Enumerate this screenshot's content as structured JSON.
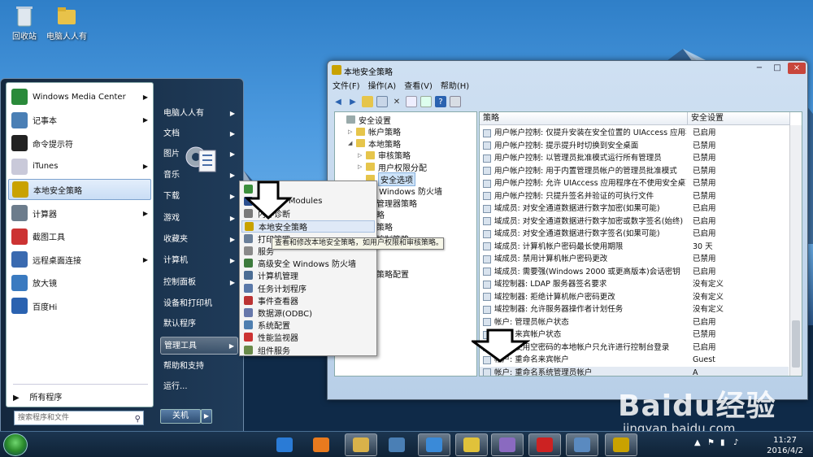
{
  "desktop": {
    "icons": [
      {
        "label": "回收站",
        "icon": "recycle-bin-icon"
      },
      {
        "label": "电脑人人有",
        "icon": "folder-icon"
      }
    ]
  },
  "start_menu": {
    "pinned": [
      {
        "label": "Windows Media Center",
        "icon": "media-center-icon",
        "has_arrow": true
      },
      {
        "label": "记事本",
        "icon": "notepad-icon",
        "has_arrow": true
      },
      {
        "label": "命令提示符",
        "icon": "cmd-icon",
        "has_arrow": false
      },
      {
        "label": "iTunes",
        "icon": "itunes-icon",
        "has_arrow": true
      },
      {
        "label": "本地安全策略",
        "icon": "security-policy-icon",
        "has_arrow": false
      },
      {
        "label": "计算器",
        "icon": "calculator-icon",
        "has_arrow": true
      },
      {
        "label": "截图工具",
        "icon": "snipping-tool-icon",
        "has_arrow": false
      },
      {
        "label": "远程桌面连接",
        "icon": "remote-desktop-icon",
        "has_arrow": true
      },
      {
        "label": "放大镜",
        "icon": "magnifier-icon",
        "has_arrow": false
      },
      {
        "label": "百度Hi",
        "icon": "baidu-hi-icon",
        "has_arrow": false
      }
    ],
    "all_programs": "所有程序",
    "search_placeholder": "搜索程序和文件",
    "right_items": [
      {
        "label": "电脑人人有",
        "has_arrow": true
      },
      {
        "label": "文档",
        "has_arrow": true
      },
      {
        "label": "图片",
        "has_arrow": true
      },
      {
        "label": "音乐",
        "has_arrow": true
      },
      {
        "label": "下载",
        "has_arrow": true
      },
      {
        "label": "游戏",
        "has_arrow": true
      },
      {
        "label": "收藏夹",
        "has_arrow": true
      },
      {
        "label": "计算机",
        "has_arrow": true
      },
      {
        "label": "控制面板",
        "has_arrow": true
      },
      {
        "label": "设备和打印机",
        "has_arrow": false
      },
      {
        "label": "默认程序",
        "has_arrow": false
      },
      {
        "label": "管理工具",
        "has_arrow": true
      },
      {
        "label": "帮助和支持",
        "has_arrow": false
      },
      {
        "label": "运行...",
        "has_arrow": false
      }
    ],
    "shutdown_label": "关机"
  },
  "admin_submenu": {
    "items": [
      {
        "label": "程序",
        "icon": "program-icon",
        "color": "#3c8f3c"
      },
      {
        "label": "erShell Modules",
        "icon": "powershell-icon",
        "color": "#2b4f8f"
      },
      {
        "label": "内存诊断",
        "icon": "memory-icon",
        "color": "#7a7a7a"
      },
      {
        "label": "本地安全策略",
        "icon": "security-policy-icon",
        "color": "#c9a200"
      },
      {
        "label": "打印管理",
        "icon": "printer-icon",
        "color": "#6a7f99"
      },
      {
        "label": "服务",
        "icon": "services-icon",
        "color": "#8a8a8a"
      },
      {
        "label": "高级安全 Windows 防火墙",
        "icon": "firewall-icon",
        "color": "#3d7b3d"
      },
      {
        "label": "计算机管理",
        "icon": "computer-management-icon",
        "color": "#4b6d94"
      },
      {
        "label": "任务计划程序",
        "icon": "task-scheduler-icon",
        "color": "#5a78a8"
      },
      {
        "label": "事件查看器",
        "icon": "event-viewer-icon",
        "color": "#b33"
      },
      {
        "label": "数据源(ODBC)",
        "icon": "odbc-icon",
        "color": "#6677aa"
      },
      {
        "label": "系统配置",
        "icon": "system-config-icon",
        "color": "#4f7fb0"
      },
      {
        "label": "性能监视器",
        "icon": "performance-icon",
        "color": "#c33"
      },
      {
        "label": "组件服务",
        "icon": "component-services-icon",
        "color": "#6a8a4a"
      }
    ],
    "tooltip": "查看和修改本地安全策略，如用户权限和审核策略。"
  },
  "window": {
    "title": "本地安全策略",
    "controls": [
      "−",
      "□",
      "×"
    ],
    "menu": [
      "文件(F)",
      "操作(A)",
      "查看(V)",
      "帮助(H)"
    ],
    "tree": [
      {
        "label": "安全设置",
        "level": 0,
        "expand": ""
      },
      {
        "label": "帐户策略",
        "level": 1,
        "expand": "▷"
      },
      {
        "label": "本地策略",
        "level": 1,
        "expand": "◢"
      },
      {
        "label": "审核策略",
        "level": 2,
        "expand": "▷"
      },
      {
        "label": "用户权限分配",
        "level": 2,
        "expand": "▷"
      },
      {
        "label": "安全选项",
        "level": 2,
        "expand": "",
        "selected": true
      },
      {
        "label": "全 Windows 防火墙",
        "level": 1,
        "expand": ""
      },
      {
        "label": "表管理器策略",
        "level": 1,
        "expand": ""
      },
      {
        "label": "策略",
        "level": 1,
        "expand": ""
      },
      {
        "label": "制策略",
        "level": 1,
        "expand": ""
      },
      {
        "label": "序控制策略",
        "level": 1,
        "expand": ""
      },
      {
        "label": "于",
        "level": 1,
        "expand": ""
      },
      {
        "label": "",
        "level": 1,
        "expand": ""
      },
      {
        "label": "核策略配置",
        "level": 1,
        "expand": ""
      }
    ],
    "columns": [
      "策略",
      "安全设置"
    ],
    "rows": [
      {
        "policy": "用户帐户控制: 仅提升安装在安全位置的 UIAccess 应用程序",
        "setting": "已启用"
      },
      {
        "policy": "用户帐户控制: 提示提升时切换到安全桌面",
        "setting": "已禁用"
      },
      {
        "policy": "用户帐户控制: 以管理员批准模式运行所有管理员",
        "setting": "已禁用"
      },
      {
        "policy": "用户帐户控制: 用于内置管理员帐户的管理员批准模式",
        "setting": "已禁用"
      },
      {
        "policy": "用户帐户控制: 允许 UIAccess 应用程序在不使用安全桌面...",
        "setting": "已禁用"
      },
      {
        "policy": "用户帐户控制: 只提升签名并验证的可执行文件",
        "setting": "已禁用"
      },
      {
        "policy": "域成员: 对安全通道数据进行数字加密(如果可能)",
        "setting": "已启用"
      },
      {
        "policy": "域成员: 对安全通道数据进行数字加密或数字签名(始终)",
        "setting": "已启用"
      },
      {
        "policy": "域成员: 对安全通道数据进行数字签名(如果可能)",
        "setting": "已启用"
      },
      {
        "policy": "域成员: 计算机帐户密码最长使用期限",
        "setting": "30 天"
      },
      {
        "policy": "域成员: 禁用计算机帐户密码更改",
        "setting": "已禁用"
      },
      {
        "policy": "域成员: 需要强(Windows 2000 或更高版本)会话密钥",
        "setting": "已启用"
      },
      {
        "policy": "域控制器: LDAP 服务器签名要求",
        "setting": "没有定义"
      },
      {
        "policy": "域控制器: 拒绝计算机帐户密码更改",
        "setting": "没有定义"
      },
      {
        "policy": "域控制器: 允许服务器操作者计划任务",
        "setting": "没有定义"
      },
      {
        "policy": "帐户: 管理员帐户状态",
        "setting": "已启用"
      },
      {
        "policy": "帐户: 来宾帐户状态",
        "setting": "已禁用"
      },
      {
        "policy": "帐户: 使用空密码的本地帐户只允许进行控制台登录",
        "setting": "已启用"
      },
      {
        "policy": "帐户: 重命名来宾帐户",
        "setting": "Guest"
      },
      {
        "policy": "帐户: 重命名系统管理员帐户",
        "setting": "A",
        "highlight": true
      }
    ]
  },
  "taskbar": {
    "clock_time": "11:27",
    "clock_date": "2016/4/2",
    "apps": [
      "ie-icon",
      "media-player-icon",
      "explorer-icon",
      "control-panel-icon",
      "sogou-icon",
      "folder-icon",
      "paint-icon",
      "game-icon",
      "screenshot-icon",
      "security-policy-icon"
    ]
  },
  "watermark": {
    "main": "Baidu经验",
    "sub": "jingyan.baidu.com"
  },
  "colors": {
    "accent": "#3a78c2",
    "menu_bg": "#1f3b59",
    "highlight": "#c9ddf5"
  }
}
